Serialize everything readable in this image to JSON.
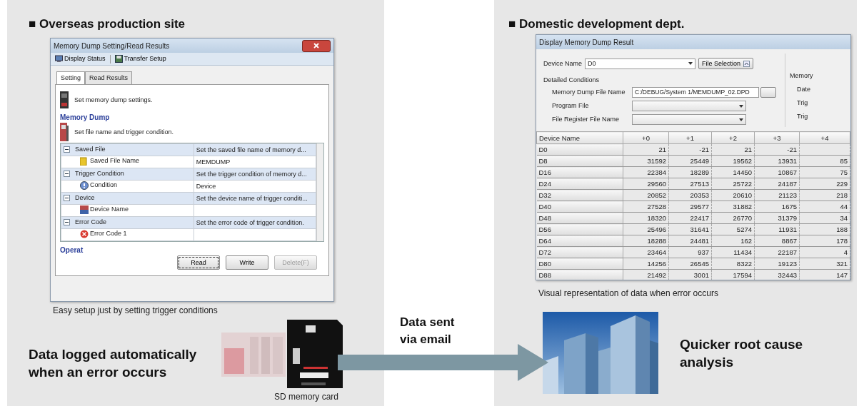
{
  "production_site": {
    "heading": "■ Overseas production site",
    "setting_window": {
      "title": "Memory Dump Setting/Read Results",
      "toolbar": [
        {
          "label": "Display Status",
          "kind": "monitor"
        },
        {
          "label": "Transfer Setup",
          "kind": "transfer"
        }
      ],
      "tabs": [
        {
          "label": "Setting",
          "selected": true
        },
        {
          "label": "Read Results",
          "selected": false
        }
      ],
      "intro": "Set memory dump settings.",
      "group_title": "Memory Dump",
      "hint": "Set file name and trigger condition.",
      "settings": [
        {
          "name": "Saved File",
          "description": "Set the saved file name of memory d...",
          "expanded": true,
          "children": [
            {
              "name": "Saved File Name",
              "value": "MEMDUMP",
              "kind": "file"
            }
          ]
        },
        {
          "name": "Trigger Condition",
          "description": "Set the trigger condition of memory d...",
          "expanded": true,
          "children": [
            {
              "name": "Condition",
              "value": "Device",
              "kind": "question"
            }
          ]
        },
        {
          "name": "Device",
          "description": "Set the device name of trigger conditi...",
          "expanded": true,
          "children": [
            {
              "name": "Device Name",
              "kind": "device"
            }
          ]
        },
        {
          "name": "Error Code",
          "description": "Set the error code of trigger condition.",
          "expanded": true,
          "children": [
            {
              "name": "Error Code 1",
              "kind": "error"
            }
          ]
        }
      ],
      "operation_title": "Operat",
      "buttons": [
        {
          "label": "Read",
          "disabled": false
        },
        {
          "label": "Write",
          "disabled": false
        },
        {
          "label": "Delete(F)",
          "disabled": true
        }
      ]
    },
    "caption": "Easy setup just by setting trigger conditions",
    "statement": "Data logged automatically when an error occurs",
    "device_caption": "SD memory card"
  },
  "transfer": {
    "label": "Data sent via email"
  },
  "development_dept": {
    "heading": "■ Domestic development dept.",
    "result_window": {
      "title": "Display Memory Dump Result",
      "device_name_label": "Device Name",
      "device_name": "D0",
      "file_selection": "File Selection",
      "conditions_title": "Detailed Conditions",
      "fields": [
        {
          "label": "Memory Dump File Name",
          "value": "C:/DEBUG/System 1/MEMDUMP_02.DPD",
          "kind": "path"
        },
        {
          "label": "Program File",
          "kind": "combo"
        },
        {
          "label": "File Register File Name",
          "kind": "combo"
        }
      ],
      "memory_group": {
        "title": "Memory",
        "labels": [
          "Date",
          "Trig",
          "Trig"
        ]
      },
      "columns": [
        "Device Name",
        "+0",
        "+1",
        "+2",
        "+3",
        "+4"
      ],
      "rows": [
        [
          "D0",
          "21",
          "-21",
          "21",
          "-21",
          ""
        ],
        [
          "D8",
          "31592",
          "25449",
          "19562",
          "13931",
          "85"
        ],
        [
          "D16",
          "22384",
          "18289",
          "14450",
          "10867",
          "75"
        ],
        [
          "D24",
          "29560",
          "27513",
          "25722",
          "24187",
          "229"
        ],
        [
          "D32",
          "20852",
          "20353",
          "20610",
          "21123",
          "218"
        ],
        [
          "D40",
          "27528",
          "29577",
          "31882",
          "1675",
          "44"
        ],
        [
          "D48",
          "18320",
          "22417",
          "26770",
          "31379",
          "34"
        ],
        [
          "D56",
          "25496",
          "31641",
          "5274",
          "11931",
          "188"
        ],
        [
          "D64",
          "18288",
          "24481",
          "162",
          "8867",
          "178"
        ],
        [
          "D72",
          "23464",
          "937",
          "11434",
          "22187",
          "4"
        ],
        [
          "D80",
          "14256",
          "26545",
          "8322",
          "19123",
          "321"
        ],
        [
          "D88",
          "21492",
          "3001",
          "17594",
          "32443",
          "147"
        ]
      ]
    },
    "caption": "Visual representation of data when error occurs",
    "statement": "Quicker root cause analysis"
  }
}
